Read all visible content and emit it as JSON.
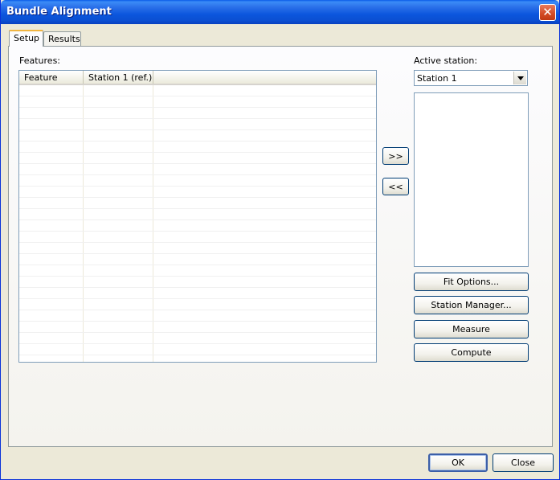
{
  "window": {
    "title": "Bundle Alignment"
  },
  "tabs": [
    {
      "label": "Setup",
      "active": true
    },
    {
      "label": "Results",
      "active": false
    }
  ],
  "features": {
    "label": "Features:",
    "columns": [
      "Feature",
      "Station 1 (ref.)"
    ],
    "rows": []
  },
  "transfer": {
    "add_label": ">>",
    "remove_label": "<<"
  },
  "active_station": {
    "label": "Active station:",
    "selected": "Station 1",
    "items": []
  },
  "actions": {
    "fit_options": "Fit Options...",
    "station_manager": "Station Manager...",
    "measure": "Measure",
    "compute": "Compute"
  },
  "footer": {
    "ok": "OK",
    "close": "Close"
  },
  "colors": {
    "titlebar": "#0b56dd",
    "face": "#ece9d8",
    "close_button": "#d24a24",
    "active_tab_accent": "#f1b541"
  }
}
